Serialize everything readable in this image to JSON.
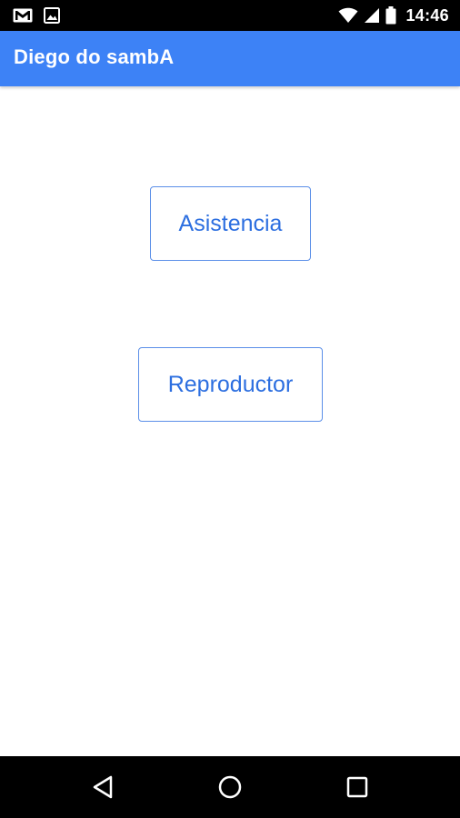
{
  "status_bar": {
    "time": "14:46",
    "notification_icons": [
      "gmail-icon",
      "image-icon"
    ],
    "system_icons": [
      "wifi-icon",
      "signal-icon",
      "battery-icon"
    ]
  },
  "app_bar": {
    "title": "Diego do sambA",
    "background_color": "#3d82f6"
  },
  "main": {
    "buttons": [
      {
        "label": "Asistencia"
      },
      {
        "label": "Reproductor"
      }
    ],
    "button_text_color": "#2d6fe0"
  },
  "nav_bar": {
    "buttons": [
      "back-icon",
      "home-icon",
      "recents-icon"
    ]
  }
}
